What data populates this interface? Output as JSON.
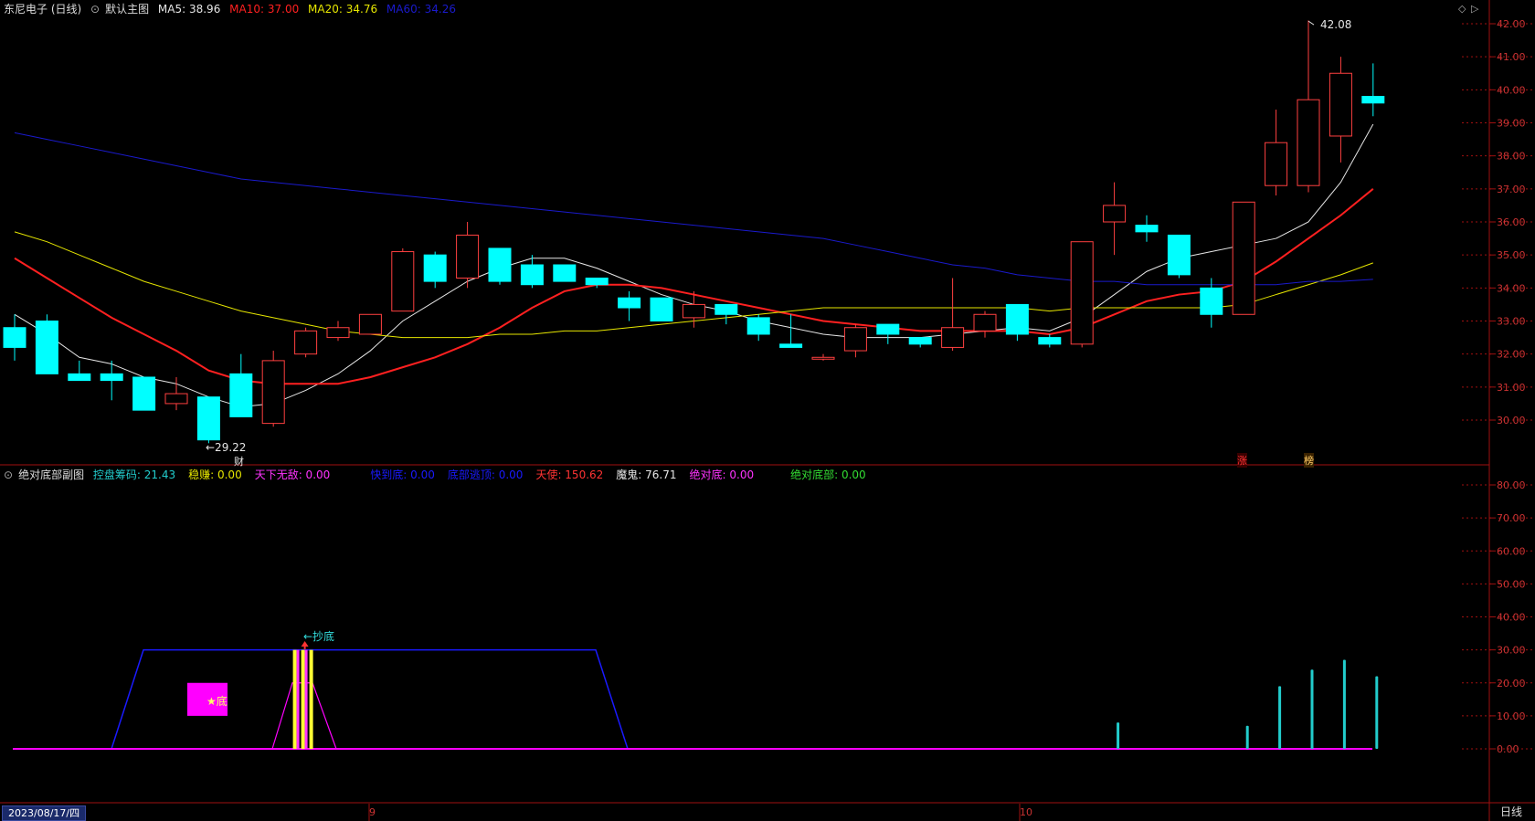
{
  "main_header": {
    "stock_title": "东尼电子 (日线)",
    "chart_name": "默认主图",
    "ma5_label": "MA5: 38.96",
    "ma10_label": "MA10: 37.00",
    "ma20_label": "MA20: 34.76",
    "ma60_label": "MA60: 34.26"
  },
  "sub_header": {
    "chart_name": "绝对底部副图",
    "items": [
      {
        "text": "控盘筹码: 21.43",
        "color": "#22cccc"
      },
      {
        "text": "稳赚: 0.00",
        "color": "#e6e600"
      },
      {
        "text": "天下无敌: 0.00",
        "color": "#ff33ff"
      },
      {
        "text": "快到底: 0.00",
        "color": "#1a1aff"
      },
      {
        "text": "底部逃顶: 0.00",
        "color": "#1a1aff"
      },
      {
        "text": "天使: 150.62",
        "color": "#ff3333"
      },
      {
        "text": "魔鬼: 76.71",
        "color": "#e6e6e6"
      },
      {
        "text": "绝对底: 0.00",
        "color": "#ff33ff"
      },
      {
        "text": "绝对底部: 0.00",
        "color": "#33dd33"
      }
    ]
  },
  "footer": {
    "date": "2023/08/17/四",
    "month_labels": [
      "9",
      "10"
    ],
    "period": "日线"
  },
  "annotations": {
    "high": "42.08",
    "low": "←29.22",
    "cai": "财",
    "zhang": "涨",
    "bang": "榜",
    "chaodi": "←抄底",
    "star_di": "★底"
  },
  "colors": {
    "up": "#ff4040",
    "down": "#00ffff",
    "ma5": "#e6e6e6",
    "ma10": "#ff2020",
    "ma20": "#e6e600",
    "ma60": "#1a1acc",
    "axis": "#a01010",
    "sub_line": "#1a1aff",
    "sub_magenta": "#ff00ff",
    "sub_bar": "#22cccc"
  },
  "chart_data": [
    {
      "type": "candlestick",
      "ylim": [
        29.0,
        42.6
      ],
      "y_ticks": [
        "30.00",
        "31.00",
        "32.00",
        "33.00",
        "34.00",
        "35.00",
        "36.00",
        "37.00",
        "38.00",
        "39.00",
        "40.00",
        "41.00",
        "42.00"
      ],
      "ohlc": [
        [
          32.8,
          33.2,
          31.8,
          32.2
        ],
        [
          33.0,
          33.2,
          31.4,
          31.4
        ],
        [
          31.4,
          31.8,
          31.2,
          31.2
        ],
        [
          31.4,
          31.8,
          30.6,
          31.2
        ],
        [
          31.3,
          31.3,
          30.3,
          30.3
        ],
        [
          30.5,
          31.3,
          30.3,
          30.8
        ],
        [
          30.7,
          30.7,
          29.3,
          29.4
        ],
        [
          31.4,
          32.0,
          30.1,
          30.1
        ],
        [
          29.9,
          32.1,
          29.8,
          31.8
        ],
        [
          32.0,
          32.8,
          31.9,
          32.7
        ],
        [
          32.5,
          33.0,
          32.4,
          32.8
        ],
        [
          32.6,
          33.2,
          32.6,
          33.2
        ],
        [
          33.3,
          35.2,
          33.3,
          35.1
        ],
        [
          35.0,
          35.1,
          34.0,
          34.2
        ],
        [
          34.3,
          36.0,
          34.0,
          35.6
        ],
        [
          35.2,
          35.2,
          34.1,
          34.2
        ],
        [
          34.7,
          35.0,
          34.0,
          34.1
        ],
        [
          34.7,
          34.7,
          34.2,
          34.2
        ],
        [
          34.3,
          34.3,
          34.0,
          34.1
        ],
        [
          33.7,
          33.9,
          33.0,
          33.4
        ],
        [
          33.7,
          33.7,
          33.0,
          33.0
        ],
        [
          33.1,
          33.9,
          32.8,
          33.5
        ],
        [
          33.5,
          33.5,
          32.9,
          33.2
        ],
        [
          33.1,
          33.2,
          32.4,
          32.6
        ],
        [
          32.3,
          33.2,
          32.2,
          32.2
        ],
        [
          31.9,
          32.0,
          31.8,
          31.9
        ],
        [
          32.1,
          32.9,
          31.9,
          32.8
        ],
        [
          32.9,
          32.9,
          32.3,
          32.6
        ],
        [
          32.5,
          32.5,
          32.2,
          32.3
        ],
        [
          32.2,
          34.3,
          32.1,
          32.8
        ],
        [
          32.7,
          33.3,
          32.5,
          33.2
        ],
        [
          33.5,
          33.5,
          32.4,
          32.6
        ],
        [
          32.5,
          32.6,
          32.2,
          32.3
        ],
        [
          32.3,
          35.4,
          32.2,
          35.4
        ],
        [
          36.0,
          37.2,
          35.0,
          36.5
        ],
        [
          35.9,
          36.2,
          35.4,
          35.7
        ],
        [
          35.6,
          35.6,
          34.3,
          34.4
        ],
        [
          34.0,
          34.3,
          32.8,
          33.2
        ],
        [
          33.2,
          36.6,
          33.2,
          36.6
        ],
        [
          37.1,
          39.4,
          36.8,
          38.4
        ],
        [
          37.1,
          42.1,
          36.9,
          39.7
        ],
        [
          38.6,
          41.0,
          37.8,
          40.5
        ],
        [
          39.8,
          40.8,
          39.2,
          39.6
        ]
      ],
      "series": [
        {
          "name": "MA5",
          "values": [
            33.2,
            32.6,
            31.9,
            31.7,
            31.3,
            31.1,
            30.7,
            30.4,
            30.5,
            30.9,
            31.4,
            32.1,
            33.0,
            33.6,
            34.2,
            34.6,
            34.9,
            34.9,
            34.6,
            34.2,
            33.8,
            33.5,
            33.3,
            33.0,
            32.8,
            32.6,
            32.5,
            32.5,
            32.5,
            32.6,
            32.7,
            32.8,
            32.7,
            33.1,
            33.8,
            34.5,
            34.9,
            35.1,
            35.3,
            35.5,
            36.0,
            37.2,
            38.96
          ]
        },
        {
          "name": "MA10",
          "values": [
            34.9,
            34.3,
            33.7,
            33.1,
            32.6,
            32.1,
            31.5,
            31.2,
            31.1,
            31.1,
            31.1,
            31.3,
            31.6,
            31.9,
            32.3,
            32.8,
            33.4,
            33.9,
            34.1,
            34.1,
            34.0,
            33.8,
            33.6,
            33.4,
            33.2,
            33.0,
            32.9,
            32.8,
            32.7,
            32.7,
            32.7,
            32.7,
            32.6,
            32.8,
            33.2,
            33.6,
            33.8,
            33.9,
            34.2,
            34.8,
            35.5,
            36.2,
            37.0
          ]
        },
        {
          "name": "MA20",
          "values": [
            35.7,
            35.4,
            35.0,
            34.6,
            34.2,
            33.9,
            33.6,
            33.3,
            33.1,
            32.9,
            32.7,
            32.6,
            32.5,
            32.5,
            32.5,
            32.6,
            32.6,
            32.7,
            32.7,
            32.8,
            32.9,
            33.0,
            33.1,
            33.2,
            33.3,
            33.4,
            33.4,
            33.4,
            33.4,
            33.4,
            33.4,
            33.4,
            33.3,
            33.4,
            33.4,
            33.4,
            33.4,
            33.4,
            33.5,
            33.8,
            34.1,
            34.4,
            34.76
          ]
        },
        {
          "name": "MA60",
          "values": [
            38.7,
            38.5,
            38.3,
            38.1,
            37.9,
            37.7,
            37.5,
            37.3,
            37.2,
            37.1,
            37.0,
            36.9,
            36.8,
            36.7,
            36.6,
            36.5,
            36.4,
            36.3,
            36.2,
            36.1,
            36.0,
            35.9,
            35.8,
            35.7,
            35.6,
            35.5,
            35.3,
            35.1,
            34.9,
            34.7,
            34.6,
            34.4,
            34.3,
            34.2,
            34.2,
            34.1,
            34.1,
            34.1,
            34.1,
            34.1,
            34.2,
            34.2,
            34.26
          ]
        }
      ]
    },
    {
      "type": "bar",
      "ylim": [
        -5,
        87
      ],
      "y_ticks": [
        "0.00",
        "10.00",
        "20.00",
        "30.00",
        "40.00",
        "50.00",
        "60.00",
        "70.00",
        "80.00"
      ],
      "blue_line": [
        [
          0,
          0
        ],
        [
          3,
          0
        ],
        [
          4,
          30
        ],
        [
          18,
          30
        ],
        [
          19,
          0
        ],
        [
          42,
          0
        ]
      ],
      "magenta_line": [
        [
          0,
          0
        ],
        [
          8,
          0
        ],
        [
          9,
          20
        ],
        [
          10,
          0
        ],
        [
          42,
          0
        ]
      ],
      "cyan_bars": [
        [
          34,
          8
        ],
        [
          38,
          7
        ],
        [
          39,
          19
        ],
        [
          40,
          24
        ],
        [
          41,
          27
        ],
        [
          42,
          22
        ]
      ],
      "signal_bars_index": 9,
      "signal_bar_value": 30,
      "pink_box": {
        "from_index": 5.5,
        "to_index": 6.7,
        "from_value": 10,
        "to_value": 20
      }
    }
  ]
}
